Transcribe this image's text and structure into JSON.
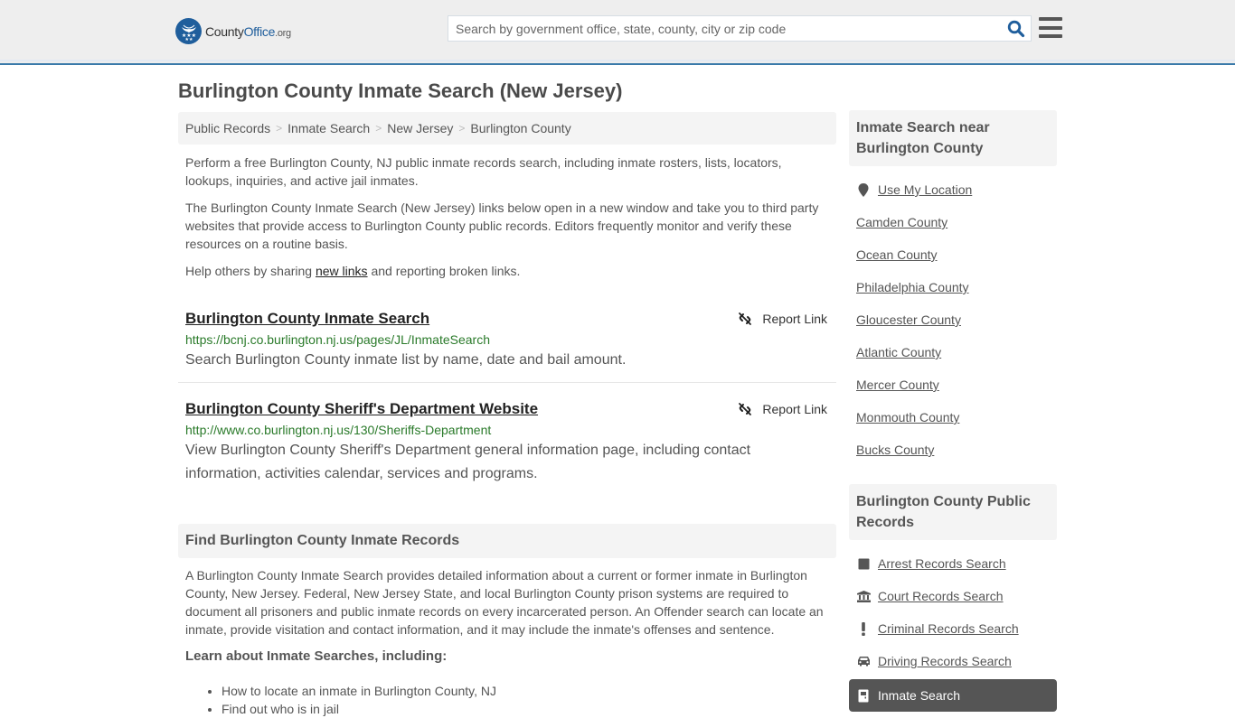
{
  "header": {
    "logo": {
      "name": "County",
      "highlight": "Office",
      "tld": ".org"
    },
    "search": {
      "placeholder": "Search by government office, state, county, city or zip code",
      "value": ""
    },
    "search_icon": "search-icon",
    "menu_icon": "hamburger-menu-icon"
  },
  "page": {
    "title": "Burlington County Inmate Search (New Jersey)",
    "breadcrumb": [
      "Public Records",
      "Inmate Search",
      "New Jersey",
      "Burlington County"
    ],
    "intro": {
      "p1": "Perform a free Burlington County, NJ public inmate records search, including inmate rosters, lists, locators, lookups, inquiries, and active jail inmates.",
      "p2": "The Burlington County Inmate Search (New Jersey) links below open in a new window and take you to third party websites that provide access to Burlington County public records. Editors frequently monitor and verify these resources on a routine basis.",
      "p3_before": "Help others by sharing ",
      "p3_link": "new links",
      "p3_after": " and reporting broken links."
    },
    "results": [
      {
        "title": "Burlington County Inmate Search",
        "url": "https://bcnj.co.burlington.nj.us/pages/JL/InmateSearch",
        "description": "Search Burlington County inmate list by name, date and bail amount.",
        "report_label": "Report Link"
      },
      {
        "title": "Burlington County Sheriff's Department Website",
        "url": "http://www.co.burlington.nj.us/130/Sheriffs-Department",
        "description": "View Burlington County Sheriff's Department general information page, including contact information, activities calendar, services and programs.",
        "report_label": "Report Link"
      }
    ],
    "find_section": {
      "heading": "Find Burlington County Inmate Records",
      "body": "A Burlington County Inmate Search provides detailed information about a current or former inmate in Burlington County, New Jersey. Federal, New Jersey State, and local Burlington County prison systems are required to document all prisoners and public inmate records on every incarcerated person. An Offender search can locate an inmate, provide visitation and contact information, and it may include the inmate's offenses and sentence.",
      "subheading": "Learn about Inmate Searches, including:",
      "bullets": [
        "How to locate an inmate in Burlington County, NJ",
        "Find out who is in jail"
      ]
    }
  },
  "sidebar": {
    "nearby": {
      "heading": "Inmate Search near Burlington County",
      "use_location": "Use My Location",
      "counties": [
        "Camden County",
        "Ocean County",
        "Philadelphia County",
        "Gloucester County",
        "Atlantic County",
        "Mercer County",
        "Monmouth County",
        "Bucks County"
      ]
    },
    "public_records": {
      "heading": "Burlington County Public Records",
      "items": [
        {
          "label": "Arrest Records Search",
          "icon": "square-icon"
        },
        {
          "label": "Court Records Search",
          "icon": "courthouse-icon"
        },
        {
          "label": "Criminal Records Search",
          "icon": "exclamation-icon"
        },
        {
          "label": "Driving Records Search",
          "icon": "car-icon"
        },
        {
          "label": "Inmate Search",
          "icon": "jail-door-icon",
          "active": true
        }
      ]
    }
  },
  "colors": {
    "brand_blue": "#1f5e9c",
    "header_border": "#3a7aaa",
    "url_green": "#2a7a2a",
    "active_item_bg": "#555555"
  }
}
